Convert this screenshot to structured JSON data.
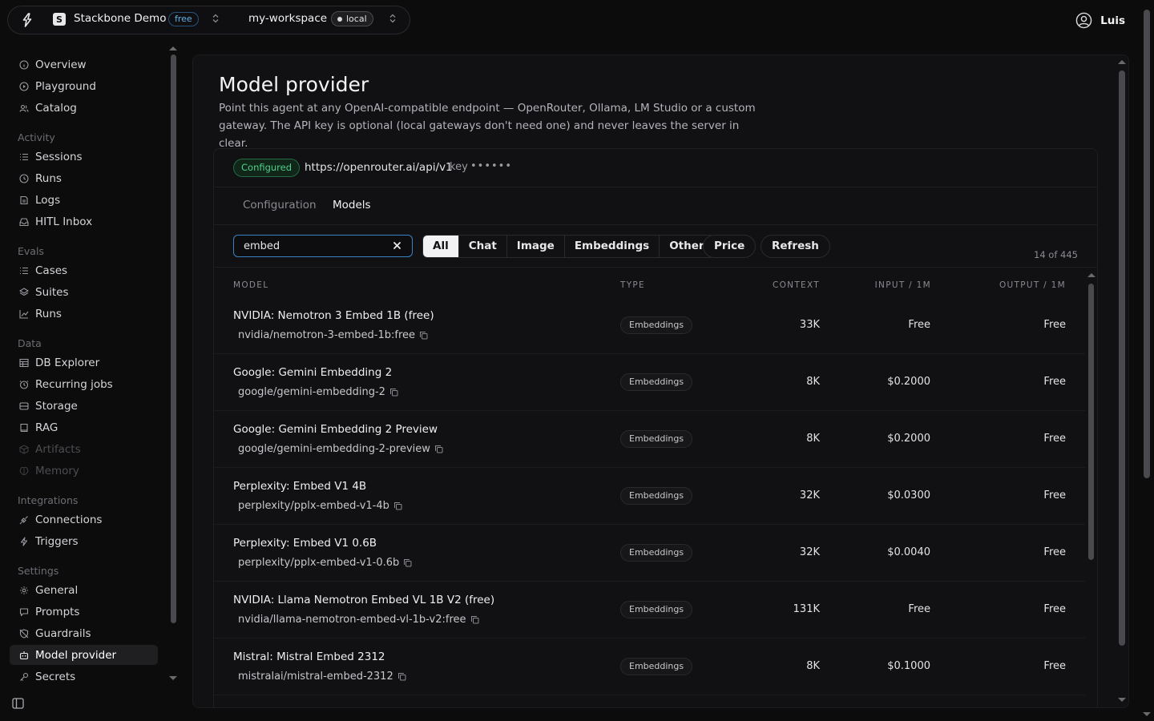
{
  "topbar": {
    "project_initial": "S",
    "project_name": "Stackbone Demo",
    "plan_badge": "free",
    "workspace_name": "my-workspace",
    "env_badge": "local",
    "user_name": "Luis"
  },
  "sidebar": {
    "top_items": [
      {
        "label": "Overview",
        "icon": "info-icon"
      },
      {
        "label": "Playground",
        "icon": "play-icon"
      },
      {
        "label": "Catalog",
        "icon": "users-icon"
      }
    ],
    "sections": [
      {
        "title": "Activity",
        "items": [
          {
            "label": "Sessions",
            "icon": "list-icon"
          },
          {
            "label": "Runs",
            "icon": "history-icon"
          },
          {
            "label": "Logs",
            "icon": "logs-icon"
          },
          {
            "label": "HITL Inbox",
            "icon": "inbox-icon"
          }
        ]
      },
      {
        "title": "Evals",
        "items": [
          {
            "label": "Cases",
            "icon": "list-icon"
          },
          {
            "label": "Suites",
            "icon": "layers-icon"
          },
          {
            "label": "Runs",
            "icon": "chart-icon"
          }
        ]
      },
      {
        "title": "Data",
        "items": [
          {
            "label": "DB Explorer",
            "icon": "table-icon"
          },
          {
            "label": "Recurring jobs",
            "icon": "clock-icon"
          },
          {
            "label": "Storage",
            "icon": "drive-icon"
          },
          {
            "label": "RAG",
            "icon": "book-icon"
          },
          {
            "label": "Artifacts",
            "icon": "box-icon",
            "disabled": true
          },
          {
            "label": "Memory",
            "icon": "brain-icon",
            "disabled": true
          }
        ]
      },
      {
        "title": "Integrations",
        "items": [
          {
            "label": "Connections",
            "icon": "plug-icon"
          },
          {
            "label": "Triggers",
            "icon": "bolt-icon"
          }
        ]
      },
      {
        "title": "Settings",
        "items": [
          {
            "label": "General",
            "icon": "gear-icon"
          },
          {
            "label": "Prompts",
            "icon": "message-icon"
          },
          {
            "label": "Guardrails",
            "icon": "shield-off-icon"
          },
          {
            "label": "Model provider",
            "icon": "bot-icon",
            "active": true
          },
          {
            "label": "Secrets",
            "icon": "key-icon"
          }
        ]
      }
    ]
  },
  "main": {
    "title": "Model provider",
    "description": "Point this agent at any OpenAI-compatible endpoint — OpenRouter, Ollama, LM Studio or a custom gateway. The API key is optional (local gateways don't need one) and never leaves the server in clear.",
    "status_badge": "Configured",
    "endpoint": "https://openrouter.ai/api/v1",
    "key_label": "key",
    "key_mask": "••••••",
    "tabs": [
      {
        "label": "Configuration",
        "active": false
      },
      {
        "label": "Models",
        "active": true
      }
    ],
    "search": {
      "value": "embed",
      "placeholder": ""
    },
    "filters": [
      {
        "label": "All",
        "active": true
      },
      {
        "label": "Chat",
        "active": false
      },
      {
        "label": "Image",
        "active": false
      },
      {
        "label": "Embeddings",
        "active": false
      },
      {
        "label": "Other",
        "active": false
      }
    ],
    "price_label": "Price",
    "refresh_label": "Refresh",
    "count": "14 of 445",
    "columns": {
      "model": "MODEL",
      "type": "TYPE",
      "context": "CONTEXT",
      "input": "INPUT / 1M",
      "output": "OUTPUT / 1M"
    },
    "rows": [
      {
        "name": "NVIDIA: Nemotron 3 Embed 1B (free)",
        "id": "nvidia/nemotron-3-embed-1b:free",
        "type": "Embeddings",
        "context": "33K",
        "input": "Free",
        "output": "Free"
      },
      {
        "name": "Google: Gemini Embedding 2",
        "id": "google/gemini-embedding-2",
        "type": "Embeddings",
        "context": "8K",
        "input": "$0.2000",
        "output": "Free"
      },
      {
        "name": "Google: Gemini Embedding 2 Preview",
        "id": "google/gemini-embedding-2-preview",
        "type": "Embeddings",
        "context": "8K",
        "input": "$0.2000",
        "output": "Free"
      },
      {
        "name": "Perplexity: Embed V1 4B",
        "id": "perplexity/pplx-embed-v1-4b",
        "type": "Embeddings",
        "context": "32K",
        "input": "$0.0300",
        "output": "Free"
      },
      {
        "name": "Perplexity: Embed V1 0.6B",
        "id": "perplexity/pplx-embed-v1-0.6b",
        "type": "Embeddings",
        "context": "32K",
        "input": "$0.0040",
        "output": "Free"
      },
      {
        "name": "NVIDIA: Llama Nemotron Embed VL 1B V2 (free)",
        "id": "nvidia/llama-nemotron-embed-vl-1b-v2:free",
        "type": "Embeddings",
        "context": "131K",
        "input": "Free",
        "output": "Free"
      },
      {
        "name": "Mistral: Mistral Embed 2312",
        "id": "mistralai/mistral-embed-2312",
        "type": "Embeddings",
        "context": "8K",
        "input": "$0.1000",
        "output": "Free"
      }
    ]
  }
}
